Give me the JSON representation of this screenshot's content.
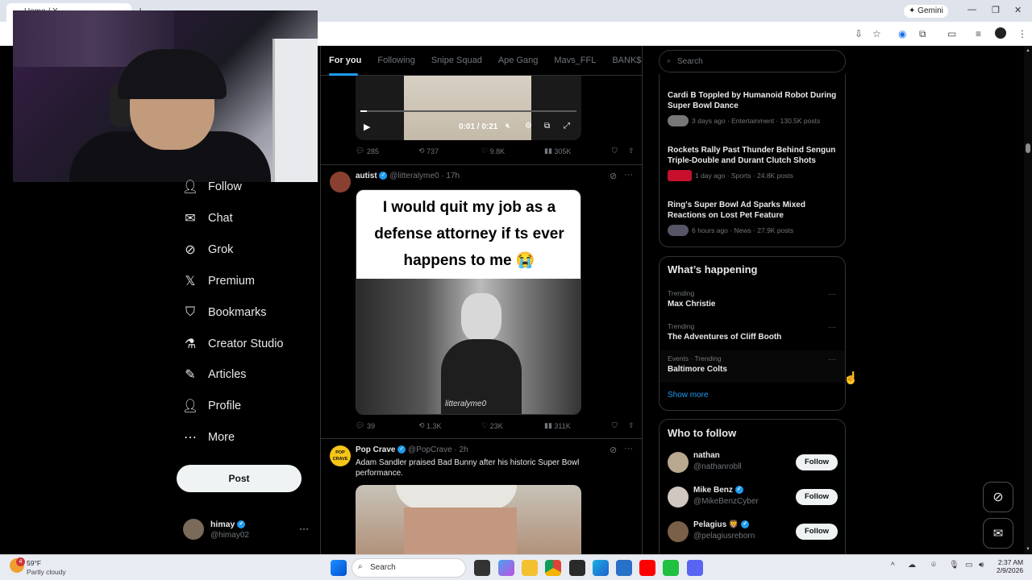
{
  "browser": {
    "tab_title": "Home / X",
    "gemini_label": "Gemini"
  },
  "nav": {
    "items": [
      {
        "label": "Follow",
        "icon": "follow-icon"
      },
      {
        "label": "Chat",
        "icon": "mail-icon"
      },
      {
        "label": "Grok",
        "icon": "grok-icon"
      },
      {
        "label": "Premium",
        "icon": "x-logo-icon"
      },
      {
        "label": "Bookmarks",
        "icon": "bookmark-icon"
      },
      {
        "label": "Creator Studio",
        "icon": "flask-icon"
      },
      {
        "label": "Articles",
        "icon": "articles-icon"
      },
      {
        "label": "Profile",
        "icon": "profile-icon"
      },
      {
        "label": "More",
        "icon": "more-circle-icon"
      }
    ],
    "post_label": "Post",
    "account": {
      "name": "himay",
      "handle": "@himay02"
    }
  },
  "feed": {
    "tabs": [
      "For you",
      "Following",
      "Snipe Squad",
      "Ape Gang",
      "Mavs_FFL",
      "BANK$ INT"
    ],
    "video": {
      "time": "0:01 / 0:21"
    },
    "post0_actions": {
      "replies": "285",
      "reposts": "737",
      "likes": "9.8K",
      "views": "305K"
    },
    "post1": {
      "name": "autist",
      "handle": "@litteralyme0",
      "time": "· 17h",
      "meme_text": "I would quit my job as a defense attorney if ts ever happens to me 😭",
      "watermark": "litteralyme0",
      "actions": {
        "replies": "39",
        "reposts": "1.3K",
        "likes": "23K",
        "views": "311K"
      }
    },
    "post2": {
      "name": "Pop Crave",
      "handle": "@PopCrave",
      "time": "· 2h",
      "text": "Adam Sandler praised Bad Bunny after his historic Super Bowl performance.",
      "avatar_text": "POP CRAVE"
    }
  },
  "right": {
    "search_placeholder": "Search",
    "news": [
      {
        "title": "Cardi B Toppled by Humanoid Robot During Super Bowl Dance",
        "meta": "3 days ago · Entertainment · 130.5K posts"
      },
      {
        "title": "Rockets Rally Past Thunder Behind Sengun Triple-Double and Durant Clutch Shots",
        "meta": "1 day ago · Sports · 24.8K posts"
      },
      {
        "title": "Ring's Super Bowl Ad Sparks Mixed Reactions on Lost Pet Feature",
        "meta": "6 hours ago · News · 27.9K posts"
      }
    ],
    "happening": {
      "title": "What’s happening",
      "trends": [
        {
          "category": "Trending",
          "name": "Max Christie"
        },
        {
          "category": "Trending",
          "name": "The Adventures of Cliff Booth"
        },
        {
          "category": "Events · Trending",
          "name": "Baltimore Colts"
        }
      ],
      "show_more": "Show more"
    },
    "who_to_follow": {
      "title": "Who to follow",
      "users": [
        {
          "name": "nathan",
          "handle": "@nathanrobll",
          "button": "Follow"
        },
        {
          "name": "Mike Benz",
          "handle": "@MikeBenzCyber",
          "button": "Follow"
        },
        {
          "name": "Pelagius 🦁",
          "handle": "@pelagiusreborn",
          "button": "Follow"
        }
      ]
    }
  },
  "taskbar": {
    "weather_temp": "59°F",
    "weather_desc": "Partly cloudy",
    "weather_badge": "4",
    "search_placeholder": "Search",
    "time": "2:37 AM",
    "date": "2/9/2026"
  },
  "colors": {
    "accent": "#1d9bf0",
    "background": "#000000",
    "text": "#e7e9ea",
    "muted": "#71767b",
    "border": "#2f3336"
  }
}
